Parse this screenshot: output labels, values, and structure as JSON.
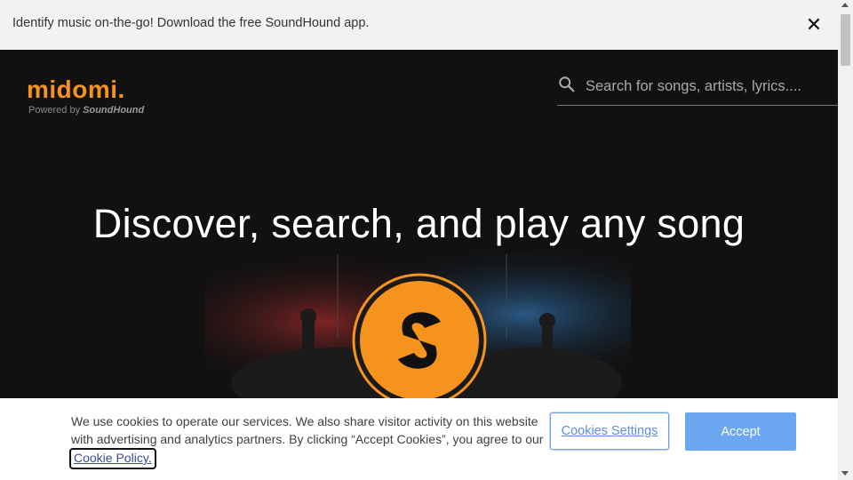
{
  "banner": {
    "text": "Identify music on-the-go! Download the free SoundHound app.",
    "close_glyph": "✕"
  },
  "header": {
    "logo_text": "midomi.",
    "logo_sub_prefix": "Powered by ",
    "logo_sub_brand": "SoundHound",
    "search_placeholder": "Search for songs, artists, lyrics...."
  },
  "hero": {
    "headline": "Discover, search, and play any song",
    "button_icon": "soundhound-logo-icon"
  },
  "cookie_banner": {
    "text": "We use cookies to operate our services. We also share visitor activity on this website with advertising and analytics partners. By clicking “Accept Cookies”, you agree to our",
    "policy_link": "Cookie Policy.",
    "settings_label": "Cookies Settings",
    "accept_label": "Accept"
  },
  "colors": {
    "brand_orange": "#f6921e",
    "dark_bg": "#111111",
    "accept_blue": "#6aa7f0"
  }
}
